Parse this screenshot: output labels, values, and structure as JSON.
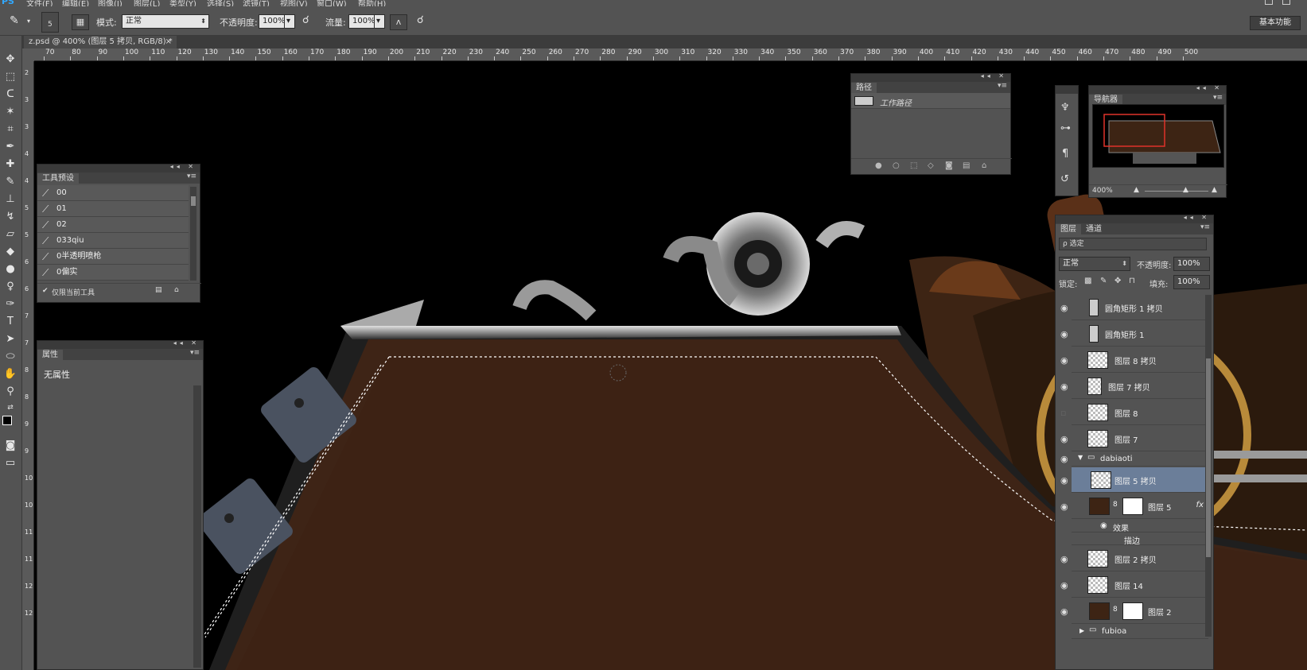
{
  "menubar": {
    "app_logo": "PS",
    "items": [
      "文件(F)",
      "编辑(E)",
      "图像(I)",
      "图层(L)",
      "类型(Y)",
      "选择(S)",
      "滤镜(T)",
      "视图(V)",
      "窗口(W)",
      "帮助(H)"
    ]
  },
  "options": {
    "brush_size": "5",
    "mode_label": "模式:",
    "mode_value": "正常",
    "opacity_label": "不透明度:",
    "opacity_value": "100%",
    "flow_label": "流量:",
    "flow_value": "100%",
    "workspace": "基本功能"
  },
  "document": {
    "tab_title": "z.psd @ 400% (图层 5 拷贝, RGB/8) *",
    "close": "×"
  },
  "rulers": {
    "top_labels": [
      "70",
      "80",
      "90",
      "100",
      "110",
      "120",
      "130",
      "140",
      "150",
      "160",
      "170",
      "180",
      "190",
      "200",
      "210",
      "220",
      "230",
      "240",
      "250",
      "260",
      "270",
      "280",
      "290",
      "300",
      "310",
      "320",
      "330",
      "340",
      "350",
      "360",
      "370",
      "380",
      "390",
      "400",
      "410",
      "420",
      "430",
      "440",
      "450",
      "460",
      "470",
      "480",
      "490",
      "500"
    ],
    "left_labels": [
      "2",
      "3",
      "3",
      "4",
      "4",
      "5",
      "5",
      "6",
      "6",
      "7",
      "7",
      "8",
      "8",
      "9",
      "9",
      "10",
      "10",
      "11",
      "11",
      "12",
      "12"
    ]
  },
  "tool_presets": {
    "title": "工具预设",
    "items": [
      "00",
      "01",
      "02",
      "033qiu",
      "0半透明喷枪",
      "0偏实"
    ],
    "current_only": "仅限当前工具",
    "check": "✔"
  },
  "properties": {
    "title": "属性",
    "empty": "无属性"
  },
  "paths": {
    "title": "路径",
    "items": [
      "工作路径"
    ]
  },
  "navigator": {
    "title": "导航器",
    "zoom": "400%"
  },
  "layers": {
    "tabs": [
      "图层",
      "通道"
    ],
    "filter_placeholder": "ρ 选定",
    "blend_mode": "正常",
    "opacity_label": "不透明度:",
    "opacity_value": "100%",
    "lock_label": "锁定:",
    "fill_label": "填充:",
    "fill_value": "100%",
    "rows": [
      {
        "name": "圆角矩形 1 拷贝",
        "visible": true
      },
      {
        "name": "圆角矩形 1",
        "visible": true
      },
      {
        "name": "图层 8 拷贝",
        "visible": true
      },
      {
        "name": "图层 7 拷贝",
        "visible": true
      },
      {
        "name": "图层 8",
        "visible": false
      },
      {
        "name": "图层 7",
        "visible": true
      },
      {
        "name": "dabiaoti",
        "visible": true
      },
      {
        "name": "图层 5 拷贝",
        "visible": true
      },
      {
        "name": "图层 5",
        "visible": true
      },
      {
        "name": "效果",
        "visible": true
      },
      {
        "name": "描边",
        "visible": true
      },
      {
        "name": "图层 2 拷贝",
        "visible": true
      },
      {
        "name": "图层 14",
        "visible": true
      },
      {
        "name": "图层 2",
        "visible": true
      },
      {
        "name": "fubioa",
        "visible": true
      }
    ],
    "fx": "fx"
  }
}
